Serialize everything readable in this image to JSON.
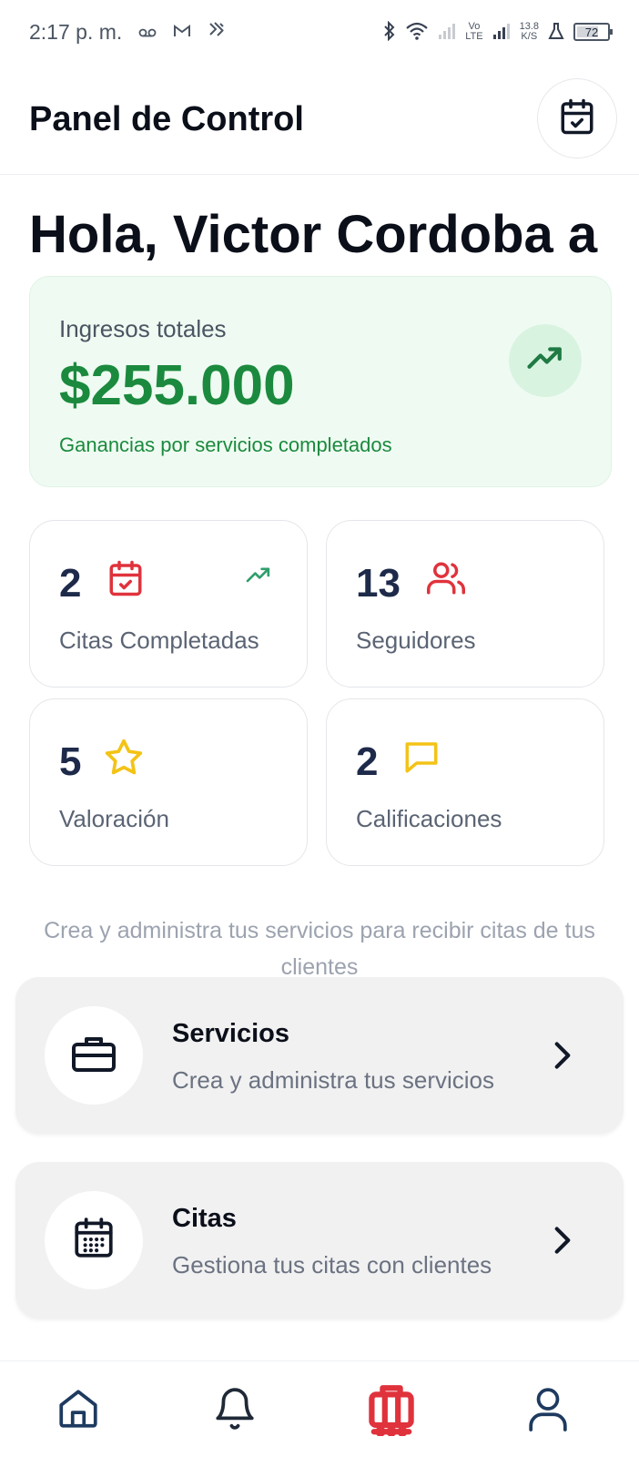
{
  "status_bar": {
    "time": "2:17 p. m.",
    "network_lines": [
      "Vo",
      "LTE"
    ],
    "speed_lines": [
      "13.8",
      "K/S"
    ],
    "battery_level": 72,
    "battery_label": "72"
  },
  "header": {
    "title": "Panel de Control",
    "calendar_icon": "calendar-check-icon"
  },
  "greeting": "Hola, Victor Cordoba a",
  "income": {
    "label": "Ingresos totales",
    "amount": "$255.000",
    "subtitle": "Ganancias por servicios completados",
    "icon": "trending-up-icon",
    "color": "#1b8a3e"
  },
  "stats": [
    {
      "value": "2",
      "label": "Citas Completadas",
      "icon": "calendar-check-icon",
      "extra_icon": "trending-up-icon"
    },
    {
      "value": "13",
      "label": "Seguidores",
      "icon": "users-icon"
    },
    {
      "value": "5",
      "label": "Valoración",
      "icon": "star-icon"
    },
    {
      "value": "2",
      "label": "Calificaciones",
      "icon": "message-square-icon"
    }
  ],
  "helper_text": "Crea y administra tus servicios para recibir citas de tus clientes",
  "menu": [
    {
      "title": "Servicios",
      "subtitle": "Crea y administra tus servicios",
      "icon": "briefcase-icon"
    },
    {
      "title": "Citas",
      "subtitle": "Gestiona tus citas con clientes",
      "icon": "calendar-grid-icon"
    }
  ],
  "bottom_nav": [
    {
      "icon": "home-icon",
      "active": false
    },
    {
      "icon": "bell-icon",
      "active": false
    },
    {
      "icon": "luggage-icon",
      "active": true
    },
    {
      "icon": "user-icon",
      "active": false
    }
  ],
  "colors": {
    "accent_red": "#e0323c",
    "accent_green": "#1b8a3e",
    "star_yellow": "#f3c316",
    "value_navy": "#1e2a4a"
  }
}
